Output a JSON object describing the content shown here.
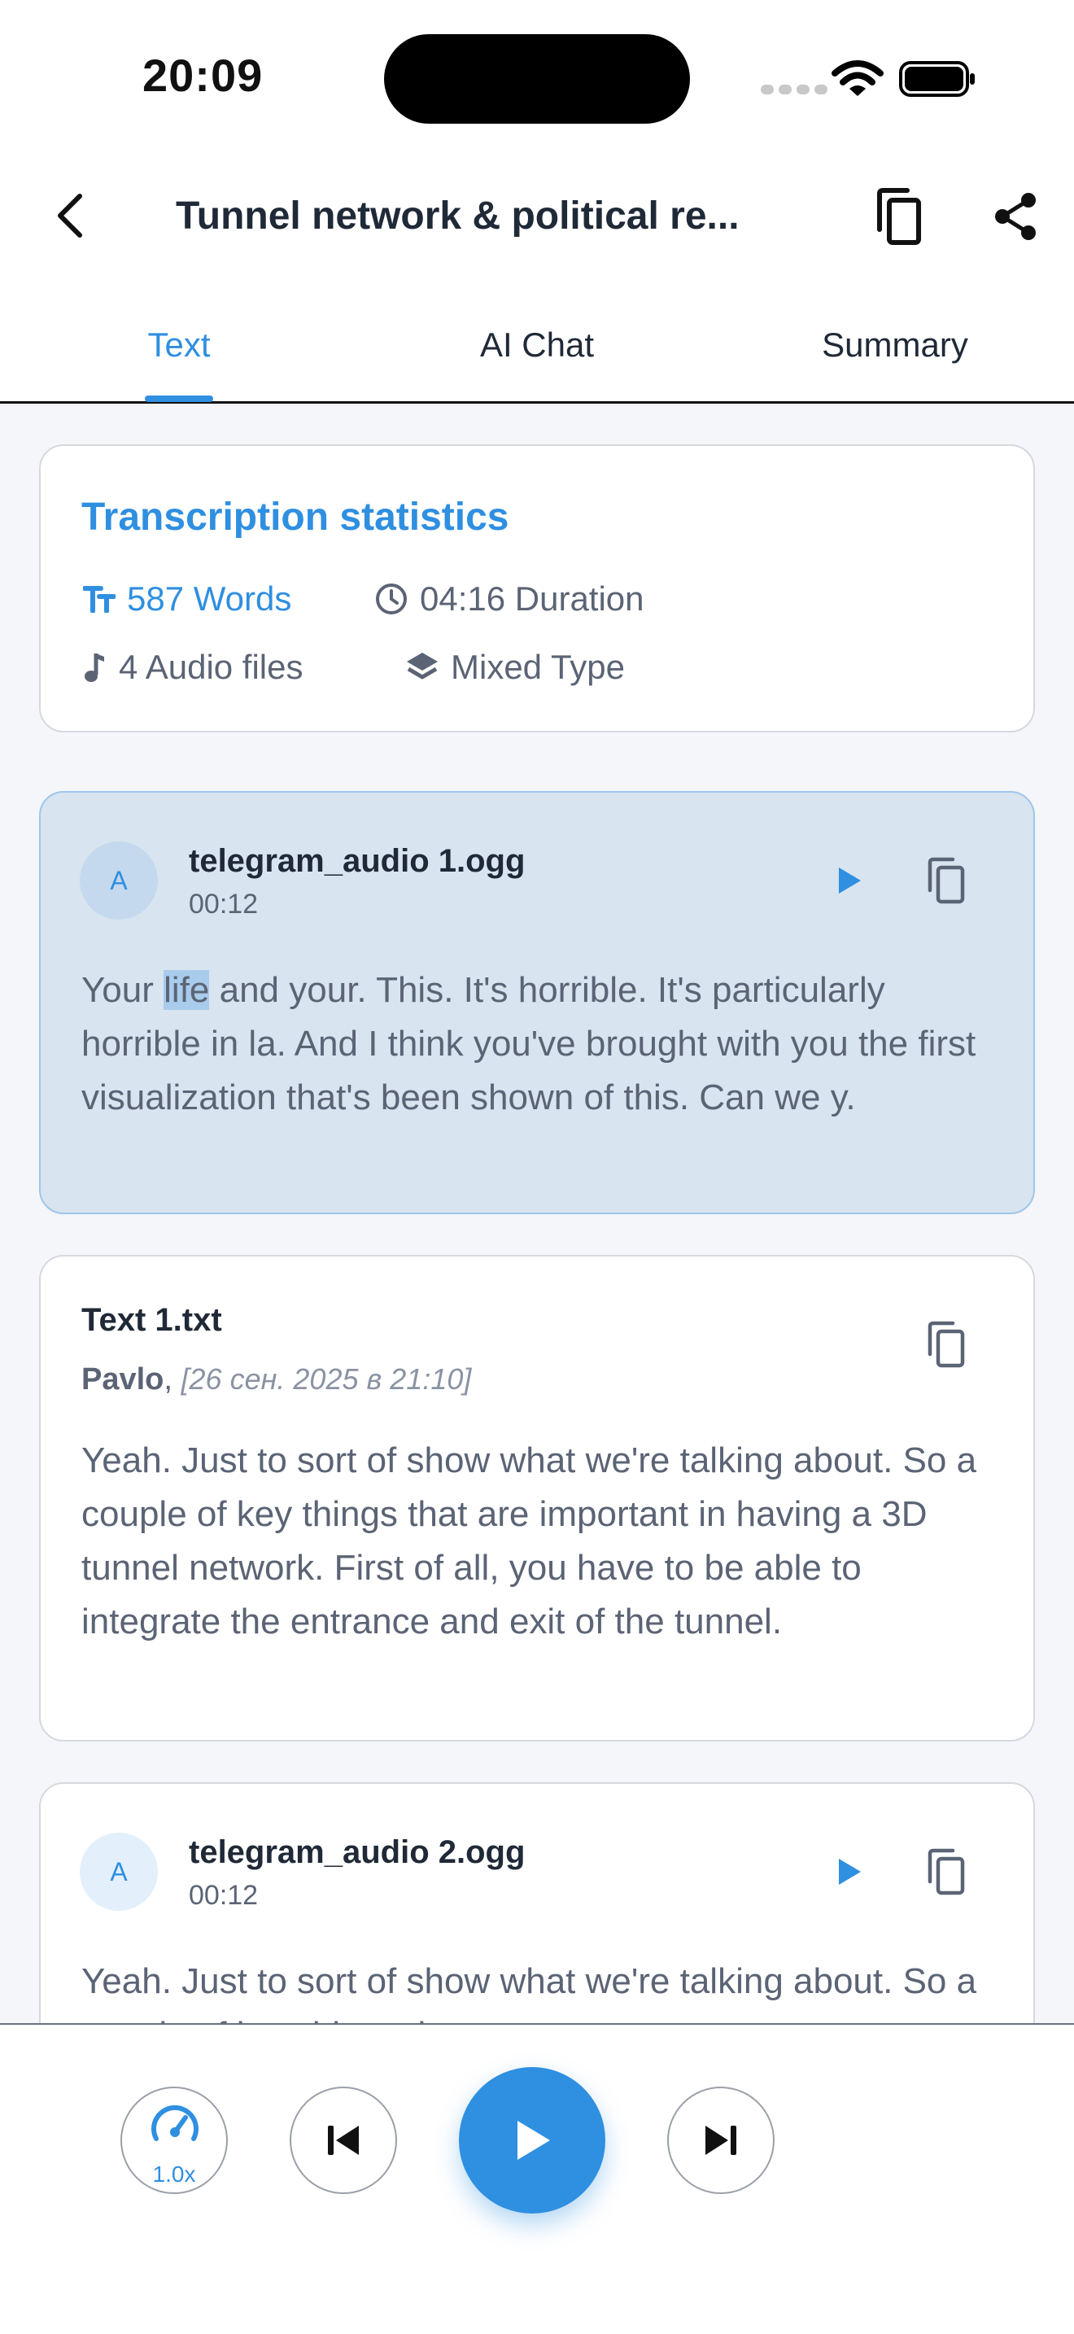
{
  "status_bar": {
    "time": "20:09"
  },
  "header": {
    "title": "Tunnel network & political re..."
  },
  "tabs": [
    {
      "label": "Text",
      "active": true
    },
    {
      "label": "AI Chat",
      "active": false
    },
    {
      "label": "Summary",
      "active": false
    }
  ],
  "stats": {
    "title": "Transcription statistics",
    "words": "587 Words",
    "duration": "04:16 Duration",
    "audio_files": "4 Audio files",
    "type": "Mixed Type"
  },
  "items": [
    {
      "avatar": "A",
      "file_name": "telegram_audio 1.ogg",
      "duration": "00:12",
      "text_before": "Your ",
      "text_highlight": "life",
      "text_after": " and your. This. It's horrible. It's particularly horrible in la. And I think you've brought with you the first visualization that's been shown of this. Can we y."
    },
    {
      "file_name": "Text 1.txt",
      "author": "Pavlo",
      "date": "[26 сен. 2025 в 21:10]",
      "text": "Yeah. Just to sort of show what we're talking about. So a couple of key things that are important in having a 3D tunnel network. First of all, you have to be able to integrate the entrance and exit of the tunnel."
    },
    {
      "avatar": "A",
      "file_name": "telegram_audio 2.ogg",
      "duration": "00:12",
      "text": "Yeah. Just to sort of show what we're talking about. So a couple of key things that are"
    }
  ],
  "player": {
    "speed": "1.0x"
  },
  "colors": {
    "accent": "#2f8fe0",
    "highlight_card": "#d8e4ef"
  },
  "icons": [
    "back-icon",
    "copy-icon",
    "share-icon",
    "text-size-icon",
    "clock-icon",
    "music-note-icon",
    "layers-icon",
    "play-icon",
    "speedometer-icon",
    "skip-previous-icon",
    "skip-next-icon"
  ]
}
